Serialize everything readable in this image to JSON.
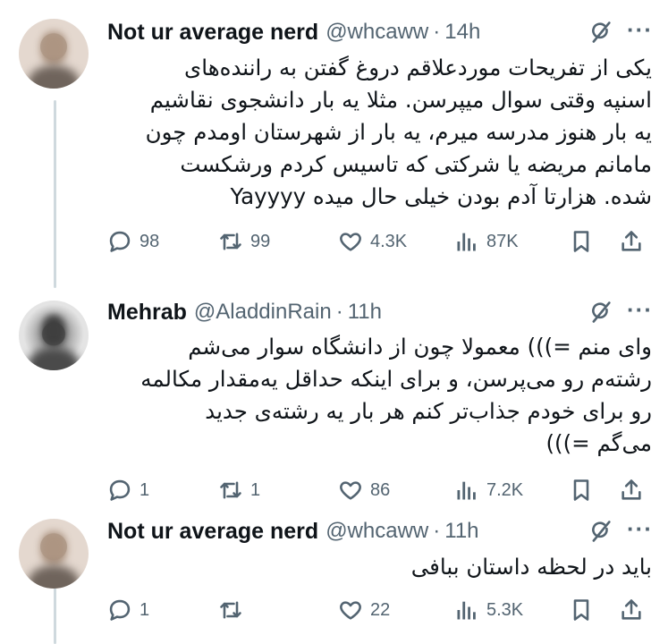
{
  "tweets": [
    {
      "name": "Not ur average nerd",
      "handle": "@whcaww",
      "separator": "·",
      "time": "14h",
      "lines": [
        "یکی از تفریحات موردعلاقم دروغ گفتن به راننده‌های",
        "اسنپه وقتی سوال میپرسن. مثلا یه بار دانشجوی نقاشیم",
        "یه بار هنوز مدرسه میرم، یه بار از شهرستان اومدم چون",
        "مامانم مریضه یا شرکتی که تاسیس کردم ورشکست",
        "شده. هزارتا آدم بودن خیلی حال میده Yayyyy"
      ],
      "replies": "98",
      "reposts": "99",
      "likes": "4.3K",
      "views": "87K"
    },
    {
      "name": "Mehrab",
      "handle": "@AladdinRain",
      "separator": "·",
      "time": "11h",
      "lines": [
        "وای منم =))) معمولا چون از دانشگاه سوار می‌شم",
        "رشته‌م رو می‌پرسن، و برای اینکه حداقل یه‌مقدار مکالمه",
        "رو برای خودم جذاب‌تر کنم هر بار یه رشته‌ی جدید",
        "می‌گم =)))"
      ],
      "replies": "1",
      "reposts": "1",
      "likes": "86",
      "views": "7.2K"
    },
    {
      "name": "Not ur average nerd",
      "handle": "@whcaww",
      "separator": "·",
      "time": "11h",
      "lines": [
        "باید در لحظه داستان ببافی"
      ],
      "replies": "1",
      "reposts": "",
      "likes": "22",
      "views": "5.3K"
    }
  ],
  "more_label": "···",
  "colors": {
    "text": "#0f1419",
    "secondary": "#536471",
    "thread_line": "#cfd9de"
  },
  "icons": [
    "reply-icon",
    "repost-icon",
    "like-icon",
    "views-icon",
    "bookmark-icon",
    "share-icon",
    "grok-icon",
    "more-icon"
  ]
}
